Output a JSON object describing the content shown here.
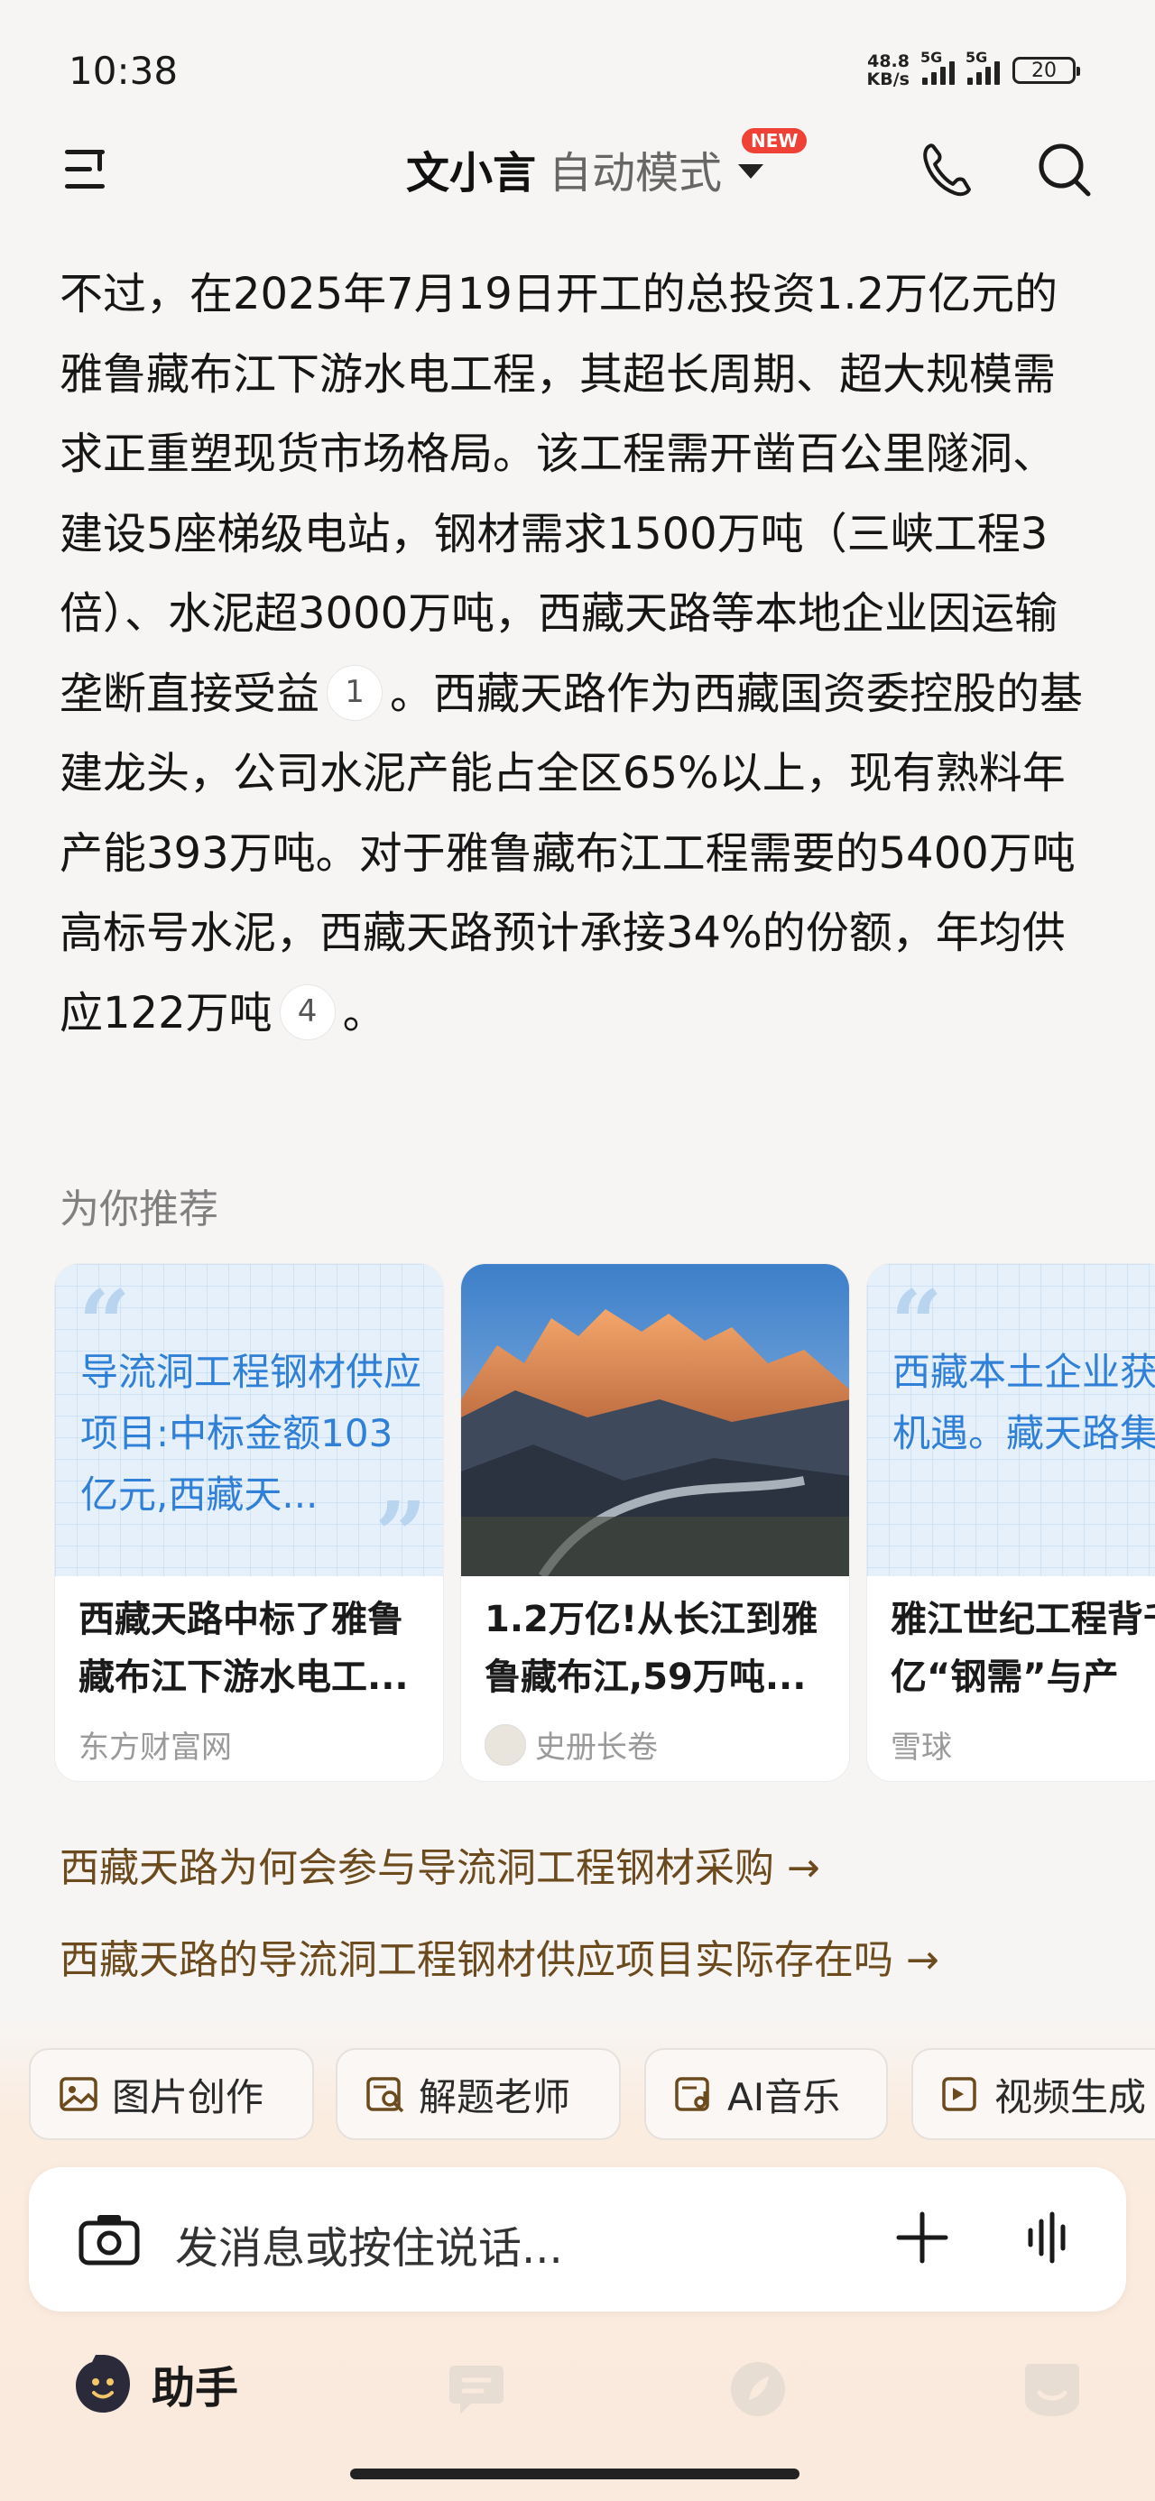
{
  "status": {
    "time": "10:38",
    "net_speed_value": "48.8",
    "net_speed_unit": "KB/s",
    "signal_label_1": "5G",
    "signal_label_2": "5G",
    "battery": "20"
  },
  "header": {
    "app_name": "文小言",
    "mode": "自动模式",
    "new_badge": "NEW"
  },
  "article": {
    "text_1": "不过，在2025年7月19日开工的总投资1.2万亿元的雅鲁藏布江下游水电工程，其超长周期、超大规模需求正重塑现货市场格局。该工程需开凿百公里隧洞、建设5座梯级电站，钢材需求1500万吨（三峡工程3倍）、水泥超3000万吨，西藏天路等本地企业因运输垄断直接受益",
    "cite_1": "1",
    "text_2": "。西藏天路作为西藏国资委控股的基建龙头，公司水泥产能占全区65%以上，现有熟料年产能393万吨。对于雅鲁藏布江工程需要的5400万吨高标号水泥，西藏天路预计承接34%的份额，年均供应122万吨",
    "cite_2": "4",
    "text_3": "。"
  },
  "recommend": {
    "title": "为你推荐",
    "cards": [
      {
        "quote": "导流洞工程钢材供应项目:中标金额103亿元,西藏天...",
        "title": "西藏天路中标了雅鲁藏布江下游水电工...",
        "source": "东方财富网"
      },
      {
        "image_desc": "snow-mountain-valley-photo",
        "title": "1.2万亿!从长江到雅鲁藏布江,59万吨...",
        "source": "史册长卷"
      },
      {
        "quote": "西藏本土企业获得意外机遇。藏天路集团凭借",
        "title": "雅江世纪工程背千亿“钢需”与产",
        "source": "雪球"
      }
    ]
  },
  "follow_ups": [
    "西藏天路为何会参与导流洞工程钢材采购 →",
    "西藏天路的导流洞工程钢材供应项目实际存在吗 →"
  ],
  "tools": [
    {
      "label": "图片创作",
      "icon": "image-icon"
    },
    {
      "label": "解题老师",
      "icon": "solve-icon"
    },
    {
      "label": "AI音乐",
      "icon": "music-icon"
    },
    {
      "label": "视频生成",
      "icon": "video-ai-icon"
    }
  ],
  "input": {
    "placeholder": "发消息或按住说话..."
  },
  "nav": {
    "assistant_label": "助手"
  }
}
